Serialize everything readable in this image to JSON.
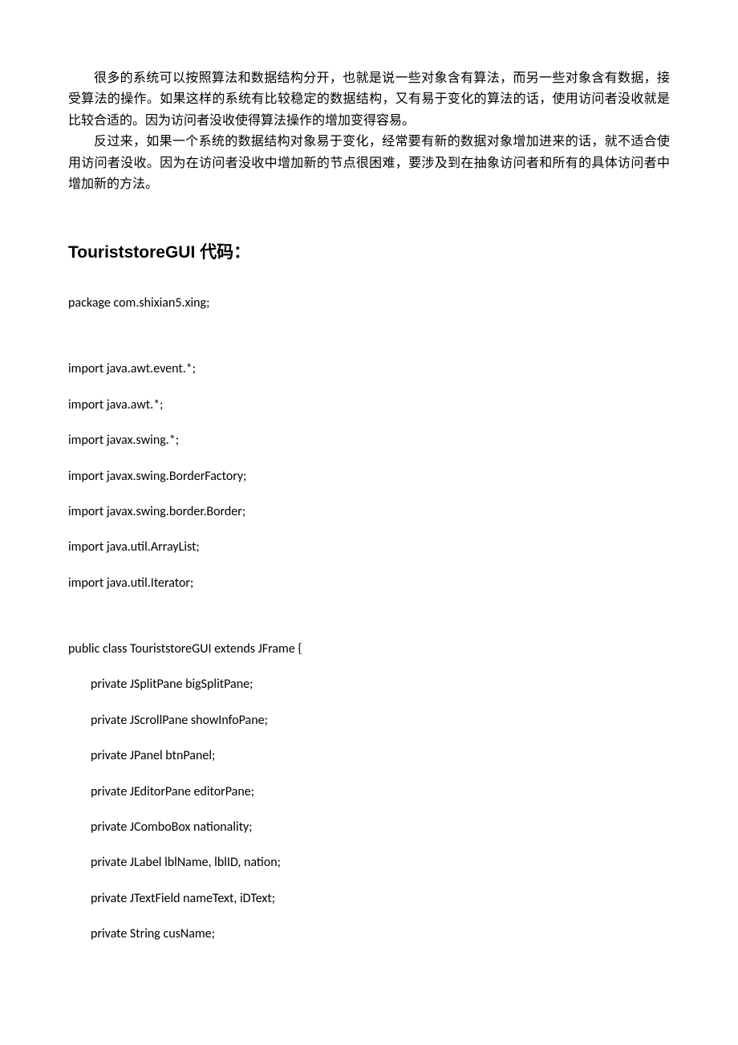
{
  "intro": {
    "paragraph1": "很多的系统可以按照算法和数据结构分开，也就是说一些对象含有算法，而另一些对象含有数据，接受算法的操作。如果这样的系统有比较稳定的数据结构，又有易于变化的算法的话，使用访问者没收就是比较合适的。因为访问者没收使得算法操作的增加变得容易。",
    "paragraph2": "反过来，如果一个系统的数据结构对象易于变化，经常要有新的数据对象增加进来的话，就不适合使用访问者没收。因为在访问者没收中增加新的节点很困难，要涉及到在抽象访问者和所有的具体访问者中增加新的方法。"
  },
  "heading": "TouriststoreGUI 代码：",
  "code": {
    "package_line": "package com.shixian5.xing;",
    "imports": [
      "import java.awt.event.*;",
      "import java.awt.*;",
      "import javax.swing.*;",
      "import javax.swing.BorderFactory;",
      "import javax.swing.border.Border;",
      "import java.util.ArrayList;",
      "import java.util.Iterator;"
    ],
    "class_decl": "public class TouriststoreGUI extends JFrame {",
    "fields": [
      "private JSplitPane     bigSplitPane;",
      "private JScrollPane showInfoPane;",
      "private JPanel btnPanel;",
      "private JEditorPane editorPane;",
      "private JComboBox nationality;",
      "private JLabel lblName, lblID, nation;",
      "private JTextField nameText, iDText;",
      "private String cusName;"
    ]
  }
}
